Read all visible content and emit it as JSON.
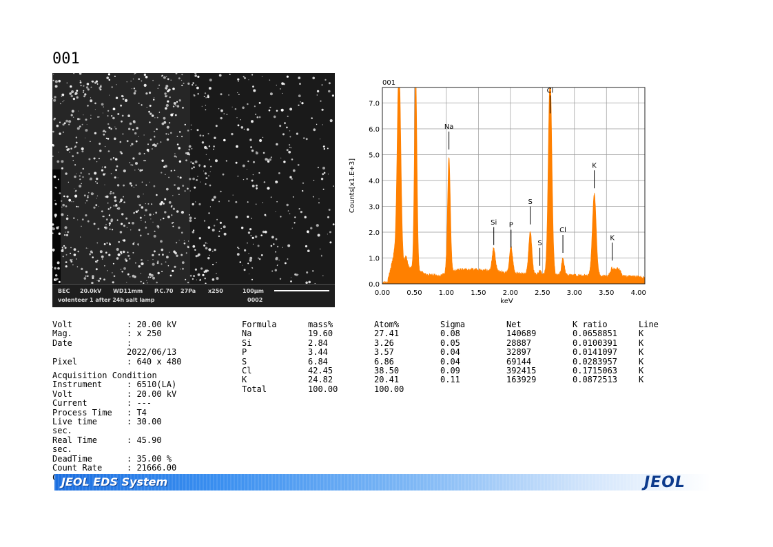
{
  "report_id": "001",
  "sem_image": {
    "mode": "BEC",
    "voltage": "20.0kV",
    "wd": "WD11mm",
    "pc": "P.C.70",
    "pressure": "27Pa",
    "mag": "x250",
    "scale": "100µm",
    "sample": "volenteer 1 after 24h salt lamp",
    "number": "0002"
  },
  "conditions": {
    "rows": [
      {
        "label": "Volt",
        "value": ": 20.00 kV"
      },
      {
        "label": "Mag.",
        "value": ": x 250"
      },
      {
        "label": "Date",
        "value": ":"
      },
      {
        "label": "",
        "value": "2022/06/13"
      },
      {
        "label": "Pixel",
        "value": ": 640 x 480"
      }
    ],
    "acquisition_title": "Acquisition Condition",
    "acquisition_rows": [
      {
        "label": "Instrument",
        "value": ": 6510(LA)"
      },
      {
        "label": "Volt",
        "value": ": 20.00 kV"
      },
      {
        "label": "Current",
        "value": ": ---"
      },
      {
        "label": "Process Time",
        "value": ": T4"
      },
      {
        "label": "Live time",
        "value": ": 30.00"
      },
      {
        "label": "sec.",
        "value": ""
      },
      {
        "label": "Real Time",
        "value": ": 45.90"
      },
      {
        "label": "sec.",
        "value": ""
      },
      {
        "label": "DeadTime",
        "value": ": 35.00 %"
      },
      {
        "label": "Count Rate",
        "value": ": 21666.00"
      },
      {
        "label": "CPS",
        "value": ""
      }
    ]
  },
  "results": {
    "headers": [
      "Formula",
      "mass%",
      "Atom%",
      "Sigma",
      "Net",
      "K ratio",
      "Line"
    ],
    "rows": [
      [
        "Na",
        "19.60",
        "27.41",
        "0.08",
        "140689",
        "0.0658851",
        "K"
      ],
      [
        "Si",
        "2.84",
        "3.26",
        "0.05",
        "28887",
        "0.0100391",
        "K"
      ],
      [
        "P",
        "3.44",
        "3.57",
        "0.04",
        "32897",
        "0.0141097",
        "K"
      ],
      [
        "S",
        "6.84",
        "6.86",
        "0.04",
        "69144",
        "0.0283957",
        "K"
      ],
      [
        "Cl",
        "42.45",
        "38.50",
        "0.09",
        "392415",
        "0.1715063",
        "K"
      ],
      [
        "K",
        "24.82",
        "20.41",
        "0.11",
        "163929",
        "0.0872513",
        "K"
      ],
      [
        "Total",
        "100.00",
        "100.00",
        "",
        "",
        "",
        ""
      ]
    ]
  },
  "chart_data": {
    "type": "area",
    "title": "001",
    "xlabel": "keV",
    "ylabel": "Counts[x1.E+3]",
    "xlim": [
      0,
      4.1
    ],
    "ylim": [
      0,
      7.6
    ],
    "x_ticks": [
      "0.00",
      "0.50",
      "1.00",
      "1.50",
      "2.00",
      "2.50",
      "3.00",
      "3.50",
      "4.00"
    ],
    "y_ticks": [
      "0.0",
      "1.0",
      "2.0",
      "3.0",
      "4.0",
      "5.0",
      "6.0",
      "7.0"
    ],
    "grid": true,
    "color": "#ff8000",
    "baseline": [
      [
        0,
        0.05
      ],
      [
        0.08,
        0.1
      ],
      [
        0.18,
        1.1
      ],
      [
        0.3,
        0.7
      ],
      [
        0.45,
        0.6
      ],
      [
        0.7,
        0.35
      ],
      [
        0.9,
        0.32
      ],
      [
        1.2,
        0.55
      ],
      [
        1.5,
        0.55
      ],
      [
        1.7,
        0.5
      ],
      [
        2.0,
        0.42
      ],
      [
        2.3,
        0.38
      ],
      [
        2.6,
        0.35
      ],
      [
        3.0,
        0.33
      ],
      [
        3.4,
        0.3
      ],
      [
        3.8,
        0.28
      ],
      [
        4.1,
        0.25
      ]
    ],
    "peaks": [
      {
        "x": 0.26,
        "height": 7.8,
        "width": 0.028
      },
      {
        "x": 0.52,
        "height": 7.8,
        "width": 0.02
      },
      {
        "x": 0.37,
        "height": 0.4,
        "width": 0.02
      },
      {
        "x": 1.04,
        "height": 4.5,
        "width": 0.022
      },
      {
        "x": 1.74,
        "height": 0.9,
        "width": 0.025
      },
      {
        "x": 2.01,
        "height": 1.0,
        "width": 0.025
      },
      {
        "x": 2.31,
        "height": 1.65,
        "width": 0.025
      },
      {
        "x": 2.46,
        "height": 0.15,
        "width": 0.02
      },
      {
        "x": 2.62,
        "height": 7.8,
        "width": 0.028
      },
      {
        "x": 2.82,
        "height": 0.65,
        "width": 0.022
      },
      {
        "x": 3.31,
        "height": 3.2,
        "width": 0.03
      },
      {
        "x": 3.59,
        "height": 0.3,
        "width": 0.03
      },
      {
        "x": 3.68,
        "height": 0.3,
        "width": 0.04
      }
    ],
    "annotations": [
      {
        "label": "Na",
        "x": 1.04,
        "y": 6.0
      },
      {
        "label": "Si",
        "x": 1.74,
        "y": 2.3
      },
      {
        "label": "P",
        "x": 2.01,
        "y": 2.2
      },
      {
        "label": "S",
        "x": 2.31,
        "y": 3.1
      },
      {
        "label": "S",
        "x": 2.46,
        "y": 1.5
      },
      {
        "label": "Cl",
        "x": 2.62,
        "y": 7.4
      },
      {
        "label": "Cl",
        "x": 2.82,
        "y": 2.0
      },
      {
        "label": "K",
        "x": 3.31,
        "y": 4.5
      },
      {
        "label": "K",
        "x": 3.59,
        "y": 1.7
      }
    ]
  },
  "footer": {
    "title": "JEOL EDS System",
    "logo": "JEOL",
    "colors": {
      "start": "#1c6fe0",
      "end": "#ffffff",
      "logo": "#0c3a8c"
    }
  }
}
